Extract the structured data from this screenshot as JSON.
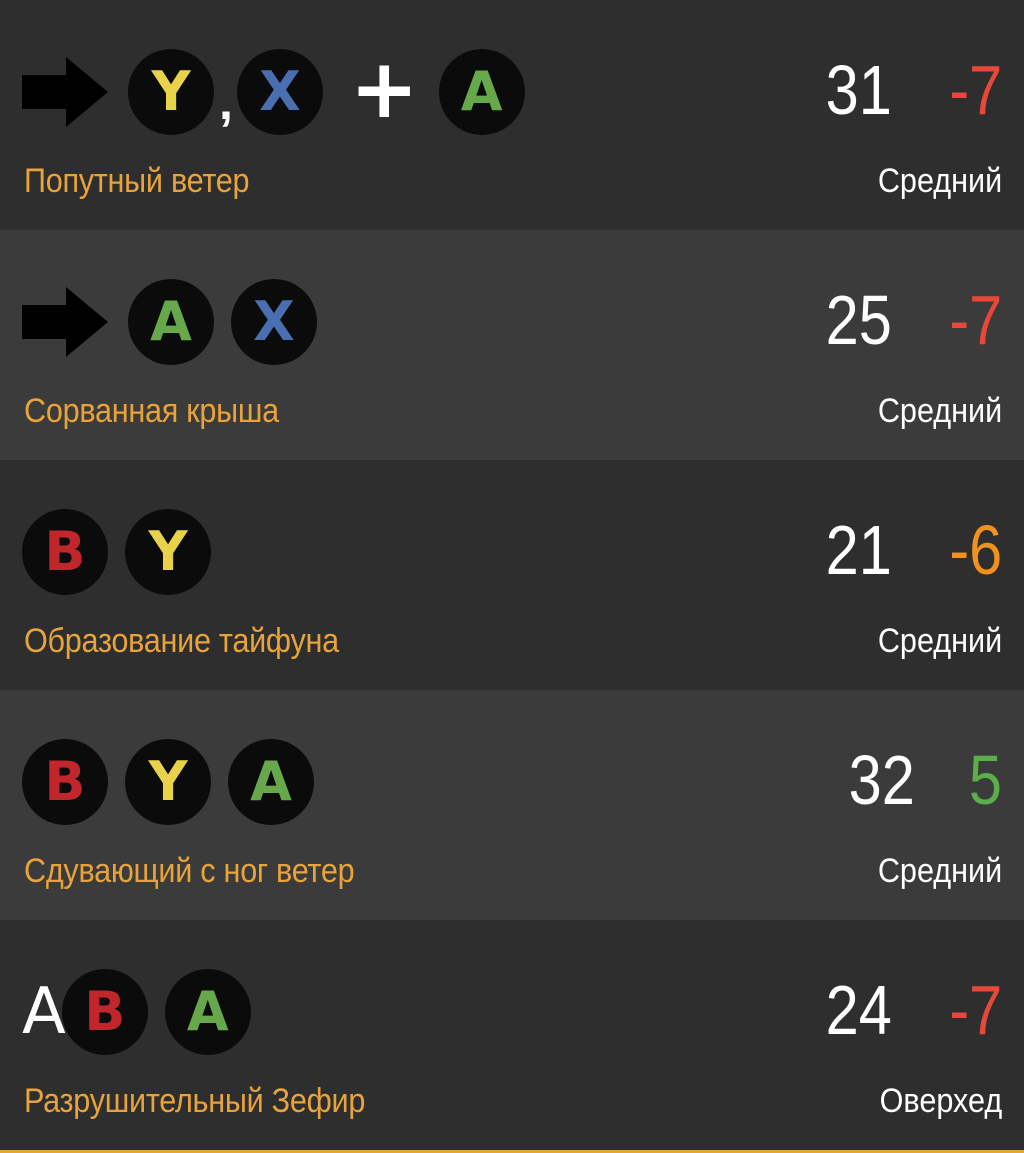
{
  "moves": [
    {
      "inputs": [
        {
          "kind": "arrow",
          "icon": "arrow-right-icon"
        },
        {
          "kind": "button",
          "letter": "Y",
          "color": "#e8d24a"
        },
        {
          "kind": "separator",
          "text": ","
        },
        {
          "kind": "button",
          "letter": "X",
          "color": "#4a6fb0"
        },
        {
          "kind": "plus",
          "text": "+"
        },
        {
          "kind": "button",
          "letter": "A",
          "color": "#67a84a"
        }
      ],
      "name": "Попутный ветер",
      "damage": "31",
      "frames": "-7",
      "frames_color": "#e8483a",
      "level": "Средний"
    },
    {
      "inputs": [
        {
          "kind": "arrow",
          "icon": "arrow-right-icon"
        },
        {
          "kind": "button",
          "letter": "A",
          "color": "#67a84a"
        },
        {
          "kind": "button",
          "letter": "X",
          "color": "#4a6fb0"
        }
      ],
      "name": "Сорванная крыша",
      "damage": "25",
      "frames": "-7",
      "frames_color": "#e8483a",
      "level": "Средний"
    },
    {
      "inputs": [
        {
          "kind": "button",
          "letter": "B",
          "color": "#c0272d"
        },
        {
          "kind": "button",
          "letter": "Y",
          "color": "#e8d24a"
        }
      ],
      "name": "Образование тайфуна",
      "damage": "21",
      "frames": "-6",
      "frames_color": "#f0921e",
      "level": "Средний"
    },
    {
      "inputs": [
        {
          "kind": "button",
          "letter": "B",
          "color": "#c0272d"
        },
        {
          "kind": "button",
          "letter": "Y",
          "color": "#e8d24a"
        },
        {
          "kind": "button",
          "letter": "A",
          "color": "#67a84a"
        }
      ],
      "name": "Сдувающий с ног ветер",
      "damage": "32",
      "frames": "5",
      "frames_color": "#5cae4a",
      "level": "Средний"
    },
    {
      "inputs": [
        {
          "kind": "plain",
          "text": "A"
        },
        {
          "kind": "button",
          "letter": "B",
          "color": "#c0272d"
        },
        {
          "kind": "button",
          "letter": "A",
          "color": "#67a84a"
        }
      ],
      "name": "Разрушительный Зефир",
      "damage": "24",
      "frames": "-7",
      "frames_color": "#e8483a",
      "level": "Оверхед"
    }
  ],
  "colors": {
    "row_dark": "#2e2e2e",
    "row_light": "#3b3b3b",
    "name_text": "#e8a33a",
    "accent_line": "#e8a33a"
  }
}
